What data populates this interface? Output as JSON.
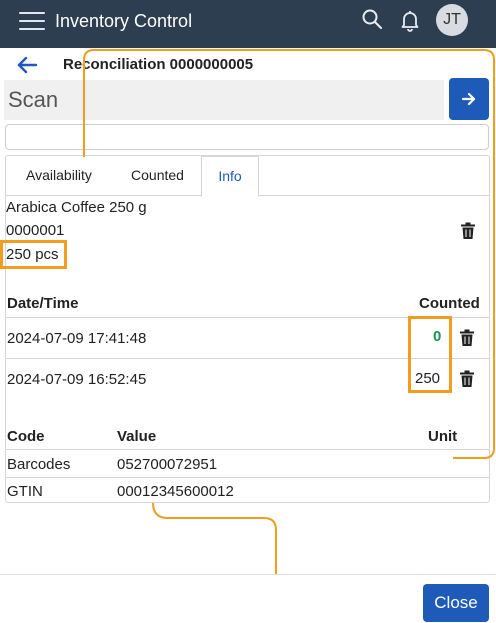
{
  "app": {
    "title": "Inventory Control",
    "user_initials": "JT"
  },
  "page": {
    "title": "Reconciliation 0000000005"
  },
  "scan": {
    "placeholder": "Scan",
    "value": ""
  },
  "tabs": [
    {
      "label": "Availability",
      "active": false
    },
    {
      "label": "Counted",
      "active": false
    },
    {
      "label": "Info",
      "active": true
    }
  ],
  "item": {
    "name": "Arabica Coffee 250 g",
    "code": "0000001",
    "quantity": "250 pcs"
  },
  "counts": {
    "headers": {
      "datetime": "Date/Time",
      "counted": "Counted"
    },
    "rows": [
      {
        "datetime": "2024-07-09 17:41:48",
        "counted": "0"
      },
      {
        "datetime": "2024-07-09 16:52:45",
        "counted": "250"
      }
    ]
  },
  "codes": {
    "headers": {
      "code": "Code",
      "value": "Value",
      "unit": "Unit"
    },
    "rows": [
      {
        "code": "Barcodes",
        "value": "052700072951",
        "unit": ""
      },
      {
        "code": "GTIN",
        "value": "00012345600012",
        "unit": ""
      }
    ]
  },
  "footer": {
    "close_label": "Close"
  },
  "colors": {
    "topbar": "#2d3e50",
    "primary": "#1e5bb8",
    "positive_count": "#1e9155",
    "annotation": "#f39c1d"
  },
  "icons": [
    "menu-icon",
    "search-icon",
    "bell-icon",
    "back-arrow-icon",
    "arrow-right-icon",
    "trash-icon"
  ]
}
